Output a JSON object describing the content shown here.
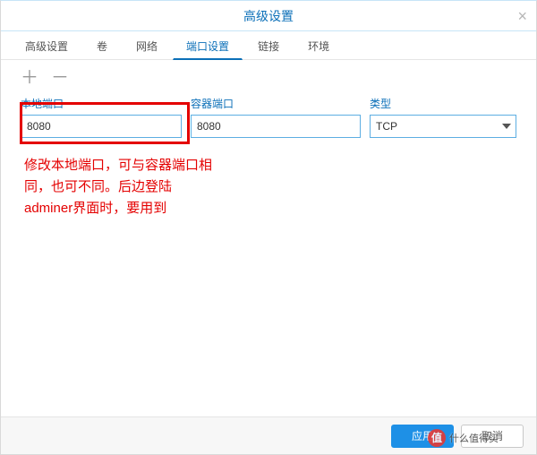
{
  "title": "高级设置",
  "tabs": {
    "items": [
      {
        "label": "高级设置"
      },
      {
        "label": "卷"
      },
      {
        "label": "网络"
      },
      {
        "label": "端口设置"
      },
      {
        "label": "链接"
      },
      {
        "label": "环境"
      }
    ],
    "active_index": 3
  },
  "toolbar": {
    "add": "＋",
    "remove": "－"
  },
  "columns": {
    "local_port": "本地端口",
    "container_port": "容器端口",
    "type": "类型"
  },
  "row": {
    "local_port": "8080",
    "container_port": "8080",
    "type": "TCP"
  },
  "annotation": "修改本地端口，可与容器端口相同，也可不同。后边登陆adminer界面时，要用到",
  "footer": {
    "apply": "应用",
    "cancel": "取消"
  },
  "watermark": {
    "badge": "值",
    "text": "什么值得买"
  }
}
